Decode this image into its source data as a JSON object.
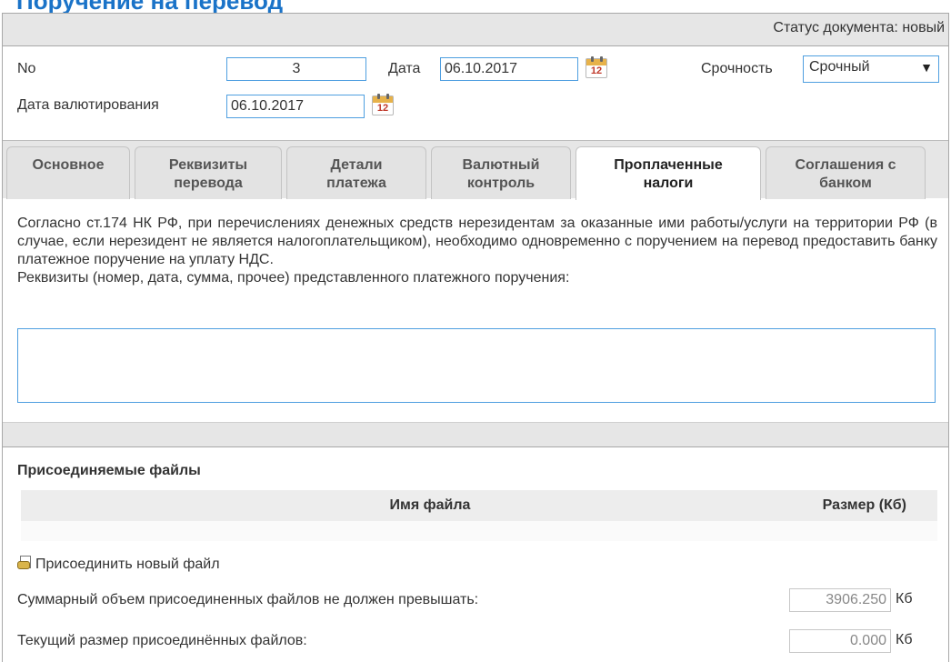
{
  "page": {
    "title": "Поручение на перевод"
  },
  "status": {
    "label": "Статус документа:",
    "value": "новый"
  },
  "header": {
    "no_label": "No",
    "no_value": "3",
    "date_label": "Дата",
    "date_value": "06.10.2017",
    "urgency_label": "Срочность",
    "urgency_value": "Срочный",
    "value_date_label": "Дата валютирования",
    "value_date_value": "06.10.2017",
    "calendar_day": "12"
  },
  "tabs": [
    {
      "line1": "Основное",
      "line2": ""
    },
    {
      "line1": "Реквизиты",
      "line2": "перевода"
    },
    {
      "line1": "Детали",
      "line2": "платежа"
    },
    {
      "line1": "Валютный",
      "line2": "контроль"
    },
    {
      "line1": "Проплаченные",
      "line2": "налоги",
      "active": true
    },
    {
      "line1": "Соглашения с",
      "line2": "банком"
    }
  ],
  "taxes": {
    "notice": "Согласно ст.174 НК РФ, при перечислениях денежных средств нерезидентам за оказанные ими работы/услуги на территории РФ (в случае, если нерезидент не является налогоплательщиком), необходимо одновременно с поручением на перевод предоставить банку платежное поручение на уплату НДС.",
    "field_label": "Реквизиты (номер, дата, сумма, прочее) представленного платежного поручения:",
    "field_value": ""
  },
  "files": {
    "section_title": "Присоединяемые файлы",
    "col_name": "Имя файла",
    "col_size": "Размер (Кб)",
    "attach_label": "Присоединить новый файл",
    "max_total_label": "Суммарный объем присоединенных файлов не должен превышать:",
    "max_total_value": "3906.250",
    "current_label": "Текущий размер присоединённых файлов:",
    "current_value": "0.000",
    "unit": "Кб"
  }
}
